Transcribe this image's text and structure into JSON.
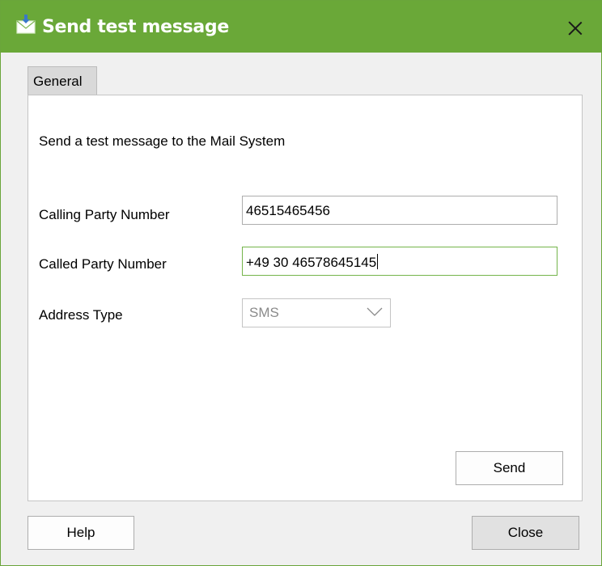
{
  "window": {
    "title": "Send test message"
  },
  "tabs": [
    {
      "label": "General"
    }
  ],
  "form": {
    "description": "Send a test message to the Mail System",
    "calling_party": {
      "label": "Calling Party Number",
      "value": "46515465456"
    },
    "called_party": {
      "label": "Called Party Number",
      "value": "+49 30 46578645145"
    },
    "address_type": {
      "label": "Address Type",
      "value": "SMS"
    }
  },
  "buttons": {
    "send": "Send",
    "help": "Help",
    "close": "Close"
  },
  "colors": {
    "titlebar": "#6aa838",
    "focus_border": "#74b44b"
  },
  "icons": {
    "title": "envelope-download-icon",
    "close": "close-icon",
    "dropdown": "chevron-down-icon"
  }
}
